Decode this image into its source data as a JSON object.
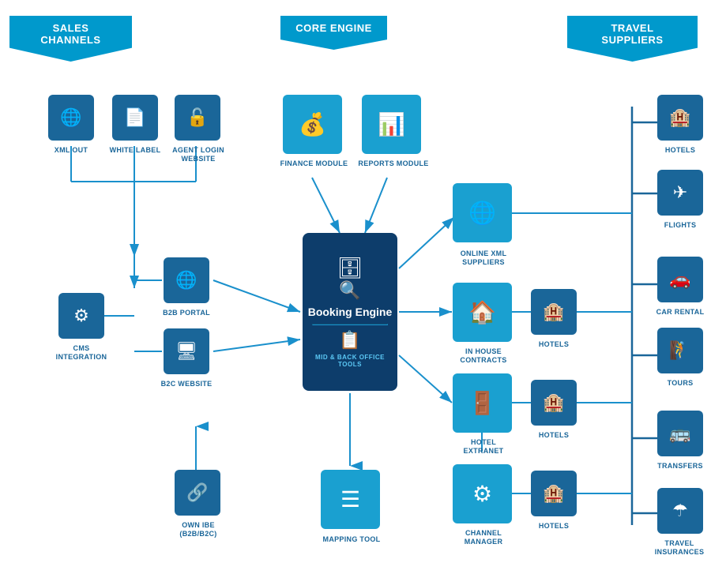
{
  "banners": {
    "sales_channels": "SALES CHANNELS",
    "core_engine": "CORE ENGINE",
    "travel_suppliers": "TRAVEL SUPPLIERS"
  },
  "sales_channels": {
    "xml_out": {
      "label": "XML OUT",
      "icon": "🌐"
    },
    "white_label": {
      "label": "WHITE LABEL",
      "icon": "📄"
    },
    "agent_login": {
      "label": "AGENT LOGIN\nWEBSITE",
      "icon": "🔓"
    },
    "b2b_portal": {
      "label": "B2B PORTAL",
      "icon": "🌐"
    },
    "b2c_website": {
      "label": "B2C WEBSITE",
      "icon": "🖥"
    },
    "cms_integration": {
      "label": "CMS\nINTEGRATION",
      "icon": "⚙"
    },
    "own_ibe": {
      "label": "OWN IBE\n(B2B/B2C)",
      "icon": "🔗"
    }
  },
  "core_engine": {
    "finance_module": {
      "label": "FINANCE MODULE",
      "icon": "💰"
    },
    "reports_module": {
      "label": "REPORTS MODULE",
      "icon": "📊"
    },
    "booking_engine_title": "Booking Engine",
    "mid_back_office": "MID & BACK OFFICE TOOLS",
    "mapping_tool": {
      "label": "MAPPING TOOL",
      "icon": "☰"
    }
  },
  "middle": {
    "online_xml_suppliers": {
      "label": "ONLINE XML\nSUPPLIERS",
      "icon": "🌐"
    },
    "in_house_contracts": {
      "label": "IN HOUSE\nCONTRACTS",
      "icon": "🏠"
    },
    "hotels_1": {
      "label": "HOTELS",
      "icon": "🏨"
    },
    "hotel_extranet": {
      "label": "HOTEL\nEXTRANET",
      "icon": "🚪"
    },
    "hotels_2": {
      "label": "HOTELS",
      "icon": "🏨"
    },
    "channel_manager": {
      "label": "CHANNEL\nMANAGER",
      "icon": "⚙"
    },
    "hotels_3": {
      "label": "HOTELS",
      "icon": "🏨"
    }
  },
  "travel_suppliers": {
    "hotels": {
      "label": "HOTELS",
      "icon": "🏨"
    },
    "flights": {
      "label": "FLIGHTS",
      "icon": "✈"
    },
    "car_rental": {
      "label": "CAR RENTAL",
      "icon": "🚗"
    },
    "tours": {
      "label": "TOURS",
      "icon": "🧗"
    },
    "transfers": {
      "label": "TRANSFERS",
      "icon": "🚌"
    },
    "travel_insurances": {
      "label": "TRAVEL\nINSURANCES",
      "icon": "☂"
    }
  },
  "colors": {
    "primary": "#1a6699",
    "dark": "#0d3d6b",
    "accent": "#0099cc",
    "arrow": "#1a90cc"
  }
}
